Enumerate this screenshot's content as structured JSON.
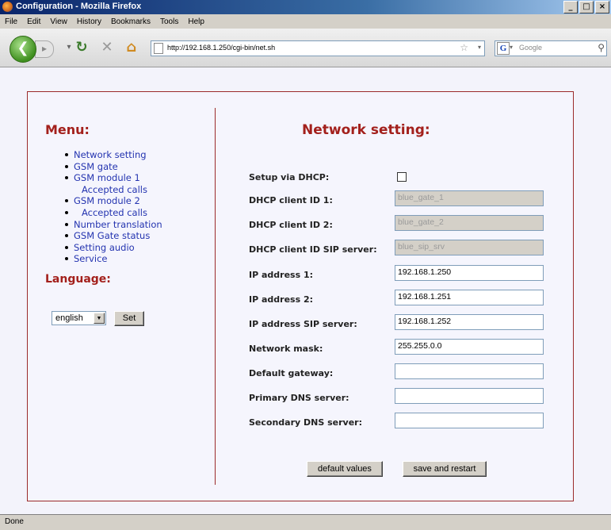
{
  "window": {
    "title": "Configuration - Mozilla Firefox",
    "buttons": [
      "_",
      "□",
      "×"
    ]
  },
  "menubar": [
    "File",
    "Edit",
    "View",
    "History",
    "Bookmarks",
    "Tools",
    "Help"
  ],
  "toolbar": {
    "url": "http://192.168.1.250/cgi-bin/net.sh",
    "search_placeholder": "Google"
  },
  "menu": {
    "heading": "Menu:",
    "items": [
      {
        "label": "Network setting",
        "sub": false
      },
      {
        "label": "GSM gate",
        "sub": false
      },
      {
        "label": "GSM module 1",
        "sub": false
      },
      {
        "label": "Accepted calls",
        "sub": true
      },
      {
        "label": "GSM module 2",
        "sub": false
      },
      {
        "label": "Accepted calls",
        "sub": true
      },
      {
        "label": "Number translation",
        "sub": false
      },
      {
        "label": "GSM Gate status",
        "sub": false
      },
      {
        "label": "Setting audio",
        "sub": false
      },
      {
        "label": "Service",
        "sub": false
      }
    ]
  },
  "language": {
    "heading": "Language:",
    "selected": "english",
    "set_label": "Set"
  },
  "network": {
    "heading": "Network setting:",
    "dhcp_label": "Setup via DHCP:",
    "fields": [
      {
        "label": "DHCP client ID 1:",
        "value": "blue_gate_1",
        "disabled": true
      },
      {
        "label": "DHCP client ID 2:",
        "value": "blue_gate_2",
        "disabled": true
      },
      {
        "label": "DHCP client ID SIP server:",
        "value": "blue_sip_srv",
        "disabled": true
      },
      {
        "label": "IP address 1:",
        "value": "192.168.1.250",
        "disabled": false
      },
      {
        "label": "IP address 2:",
        "value": "192.168.1.251",
        "disabled": false
      },
      {
        "label": "IP address SIP server:",
        "value": "192.168.1.252",
        "disabled": false
      },
      {
        "label": "Network mask:",
        "value": "255.255.0.0",
        "disabled": false
      },
      {
        "label": "Default gateway:",
        "value": "",
        "disabled": false
      },
      {
        "label": "Primary DNS server:",
        "value": "",
        "disabled": false
      },
      {
        "label": "Secondary DNS server:",
        "value": "",
        "disabled": false
      }
    ],
    "default_button": "default values",
    "save_button": "save and restart"
  },
  "status": "Done"
}
